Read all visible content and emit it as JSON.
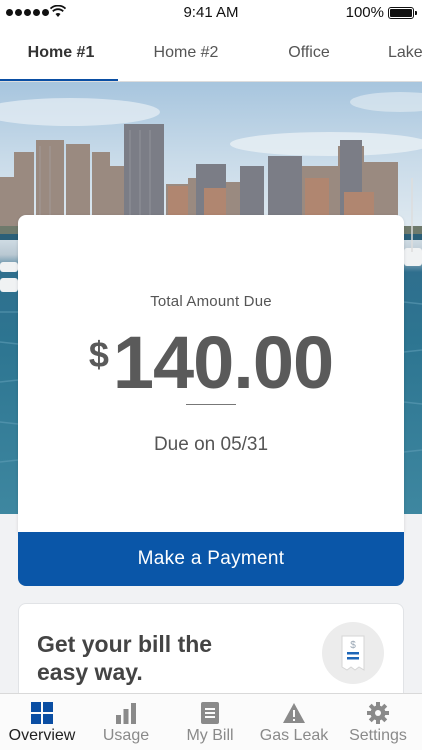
{
  "status_bar": {
    "time": "9:41 AM",
    "battery_percent": "100%",
    "signal_dots": 5
  },
  "tabs": [
    {
      "label": "Home #1",
      "active": true
    },
    {
      "label": "Home #2",
      "active": false
    },
    {
      "label": "Office",
      "active": false
    },
    {
      "label": "Lake",
      "active": false
    }
  ],
  "bill": {
    "amount_label": "Total Amount Due",
    "currency_symbol": "$",
    "amount": "140.00",
    "due_text": "Due on 05/31"
  },
  "pay_button": {
    "label": "Make a Payment"
  },
  "promo": {
    "headline": "Get your bill the easy way.",
    "icon": "paper-bill-icon"
  },
  "bottom_nav": [
    {
      "label": "Overview",
      "icon": "grid-icon",
      "active": true
    },
    {
      "label": "Usage",
      "icon": "bar-chart-icon",
      "active": false
    },
    {
      "label": "My Bill",
      "icon": "document-icon",
      "active": false
    },
    {
      "label": "Gas Leak",
      "icon": "warning-icon",
      "active": false
    },
    {
      "label": "Settings",
      "icon": "gear-icon",
      "active": false
    }
  ],
  "colors": {
    "brand_blue": "#0a56a8",
    "active_nav": "#0a4ea3",
    "amount_text": "#5a5a5a"
  }
}
